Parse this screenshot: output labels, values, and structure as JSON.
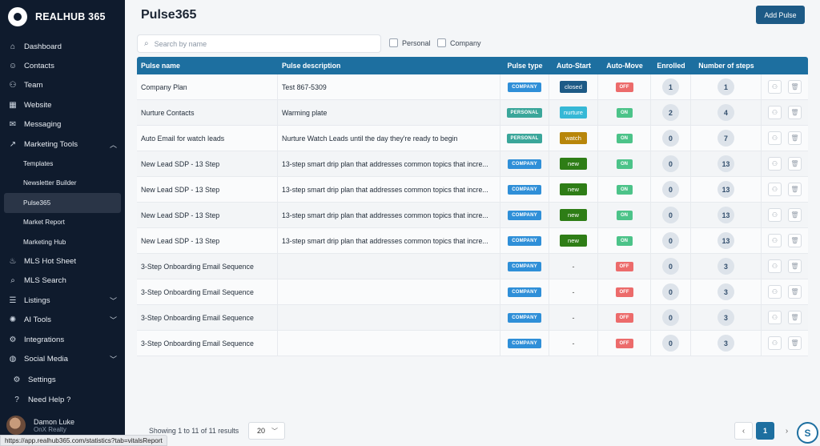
{
  "brand": {
    "name": "REALHUB 365"
  },
  "sidebar": {
    "items": [
      {
        "label": "Dashboard",
        "icon": "dashboard-icon"
      },
      {
        "label": "Contacts",
        "icon": "smiley-icon"
      },
      {
        "label": "Team",
        "icon": "team-icon"
      },
      {
        "label": "Website",
        "icon": "grid-icon"
      },
      {
        "label": "Messaging",
        "icon": "mail-icon"
      },
      {
        "label": "Marketing Tools",
        "icon": "trend-icon"
      }
    ],
    "marketing_sub": [
      {
        "label": "Templates"
      },
      {
        "label": "Newsletter Builder"
      },
      {
        "label": "Pulse365"
      },
      {
        "label": "Market Report"
      },
      {
        "label": "Marketing Hub"
      }
    ],
    "items2": [
      {
        "label": "MLS Hot Sheet",
        "icon": "flame-icon"
      },
      {
        "label": "MLS Search",
        "icon": "search-icon"
      },
      {
        "label": "Listings",
        "icon": "listings-icon"
      },
      {
        "label": "AI Tools",
        "icon": "ai-icon"
      },
      {
        "label": "Integrations",
        "icon": "integrations-icon"
      },
      {
        "label": "Social Media",
        "icon": "globe-icon"
      }
    ],
    "settings": "Settings",
    "help": "Need Help ?",
    "user": {
      "name": "Damon Luke",
      "org": "OnX Realty"
    }
  },
  "status_url": "https://app.realhub365.com/statistics?tab=vitalsReport",
  "header": {
    "title": "Pulse365",
    "add_label": "Add Pulse"
  },
  "search": {
    "placeholder": "Search by name",
    "value": ""
  },
  "filters": {
    "personal": "Personal",
    "company": "Company"
  },
  "table": {
    "columns": [
      "Pulse name",
      "Pulse description",
      "Pulse type",
      "Auto-Start",
      "Auto-Move",
      "Enrolled",
      "Number of steps"
    ],
    "rows": [
      {
        "name": "Company Plan",
        "desc": "Test 867-5309",
        "type": "COMPANY",
        "auto": "closed",
        "move": "OFF",
        "enrolled": "1",
        "steps": "1"
      },
      {
        "name": "Nurture Contacts",
        "desc": "Warming plate",
        "type": "PERSONAL",
        "auto": "nurture",
        "move": "ON",
        "enrolled": "2",
        "steps": "4"
      },
      {
        "name": "Auto Email for watch leads",
        "desc": "Nurture Watch Leads until the day they're ready to begin",
        "type": "PERSONAL",
        "auto": "watch",
        "move": "ON",
        "enrolled": "0",
        "steps": "7"
      },
      {
        "name": "New Lead SDP - 13 Step",
        "desc": "13-step smart drip plan that addresses common topics that incre...",
        "type": "COMPANY",
        "auto": "new",
        "move": "ON",
        "enrolled": "0",
        "steps": "13"
      },
      {
        "name": "New Lead SDP - 13 Step",
        "desc": "13-step smart drip plan that addresses common topics that incre...",
        "type": "COMPANY",
        "auto": "new",
        "move": "ON",
        "enrolled": "0",
        "steps": "13"
      },
      {
        "name": "New Lead SDP - 13 Step",
        "desc": "13-step smart drip plan that addresses common topics that incre...",
        "type": "COMPANY",
        "auto": "new",
        "move": "ON",
        "enrolled": "0",
        "steps": "13"
      },
      {
        "name": "New Lead SDP - 13 Step",
        "desc": "13-step smart drip plan that addresses common topics that incre...",
        "type": "COMPANY",
        "auto": "new",
        "move": "ON",
        "enrolled": "0",
        "steps": "13"
      },
      {
        "name": "3-Step Onboarding Email Sequence",
        "desc": "",
        "type": "COMPANY",
        "auto": "-",
        "move": "OFF",
        "enrolled": "0",
        "steps": "3"
      },
      {
        "name": "3-Step Onboarding Email Sequence",
        "desc": "",
        "type": "COMPANY",
        "auto": "-",
        "move": "OFF",
        "enrolled": "0",
        "steps": "3"
      },
      {
        "name": "3-Step Onboarding Email Sequence",
        "desc": "",
        "type": "COMPANY",
        "auto": "-",
        "move": "OFF",
        "enrolled": "0",
        "steps": "3"
      },
      {
        "name": "3-Step Onboarding Email Sequence",
        "desc": "",
        "type": "COMPANY",
        "auto": "-",
        "move": "OFF",
        "enrolled": "0",
        "steps": "3"
      }
    ]
  },
  "footer": {
    "results": "Showing 1 to 11 of 11 results",
    "page_size": "20",
    "current_page": "1"
  },
  "colors": {
    "company": "#2f8fd8",
    "personal": "#3aa69a",
    "closed": "#1d5a86",
    "nurture": "#36b8d6",
    "watch": "#b8860b",
    "new": "#2e7d16",
    "on": "#4cc389",
    "off": "#ec6b6b"
  }
}
